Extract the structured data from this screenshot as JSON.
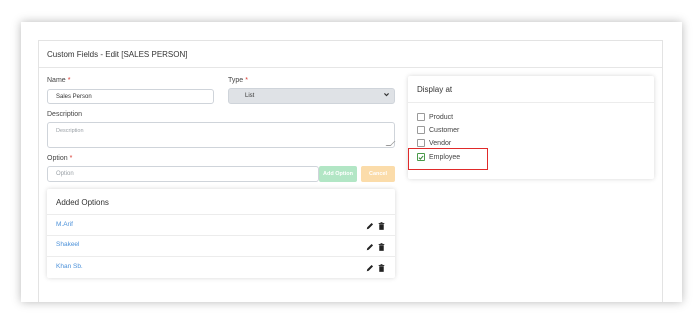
{
  "title": "Custom Fields - Edit [SALES PERSON]",
  "form": {
    "name_label": "Name",
    "name_value": "Sales Person",
    "type_label": "Type",
    "type_value": "List",
    "description_label": "Description",
    "description_placeholder": "Description",
    "option_label": "Option",
    "option_placeholder": "Option",
    "required_mark": "*",
    "add_option_label": "Add Option",
    "cancel_label": "Cancel"
  },
  "added_options": {
    "title": "Added Options",
    "items": [
      {
        "label": "M.Arif"
      },
      {
        "label": "Shakeel"
      },
      {
        "label": "Khan Sb."
      }
    ]
  },
  "display_at": {
    "title": "Display at",
    "items": [
      {
        "label": "Product",
        "checked": false
      },
      {
        "label": "Customer",
        "checked": false
      },
      {
        "label": "Vendor",
        "checked": false
      },
      {
        "label": "Employee",
        "checked": true
      }
    ]
  },
  "colors": {
    "required": "#d9342b",
    "link": "#4a90d9",
    "add_button": "#b2e6c5",
    "cancel_button": "#fbdcaa",
    "highlight": "#e02a2a"
  }
}
